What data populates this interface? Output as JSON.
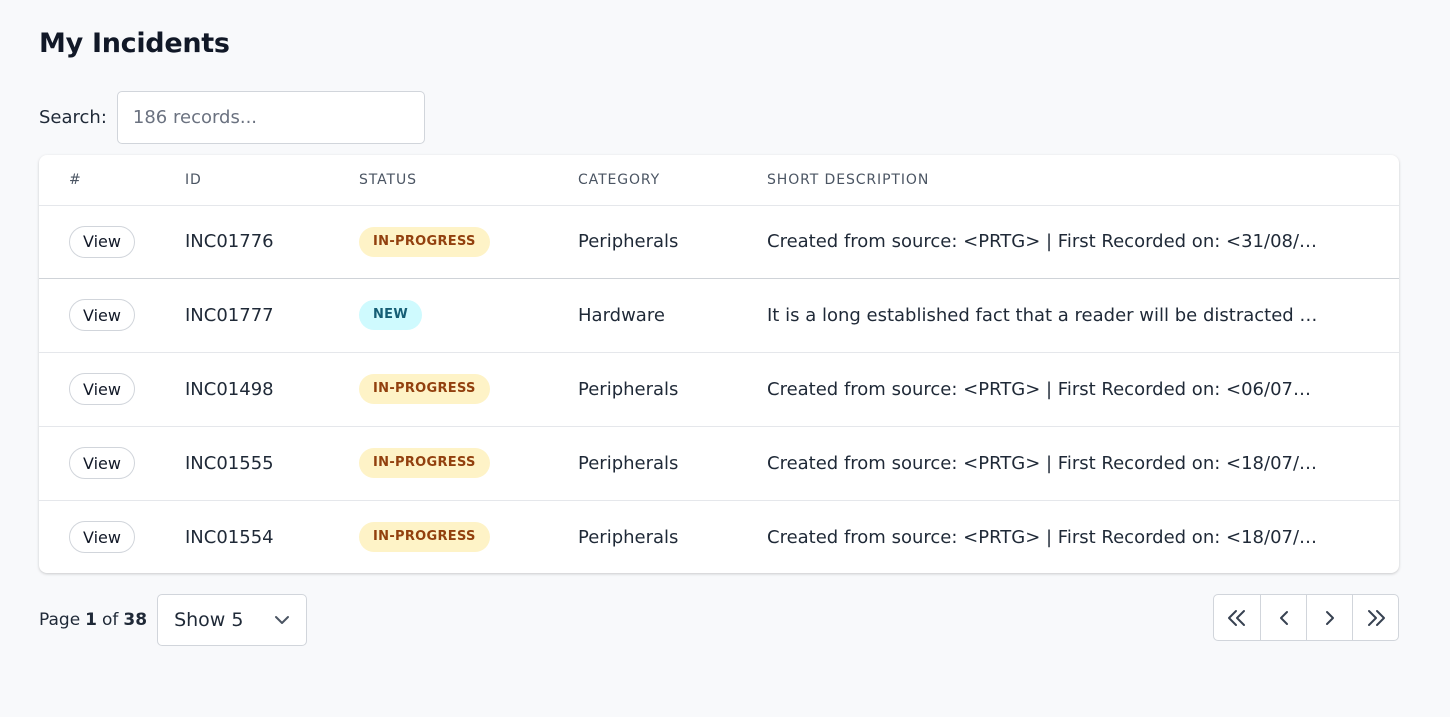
{
  "page": {
    "title": "My Incidents"
  },
  "search": {
    "label": "Search:",
    "placeholder": "186 records..."
  },
  "table": {
    "columns": {
      "num": "#",
      "id": "ID",
      "status": "STATUS",
      "category": "CATEGORY",
      "description": "SHORT DESCRIPTION"
    },
    "rows": [
      {
        "action": "View",
        "id": "INC01776",
        "status": "IN-PROGRESS",
        "category": "Peripherals",
        "description": "Created from source: <PRTG> | First Recorded on: <31/08/…"
      },
      {
        "action": "View",
        "id": "INC01777",
        "status": "NEW",
        "category": "Hardware",
        "description": "It is a long established fact that a reader will be distracted …"
      },
      {
        "action": "View",
        "id": "INC01498",
        "status": "IN-PROGRESS",
        "category": "Peripherals",
        "description": "Created from source: <PRTG> | First Recorded on: <06/07…"
      },
      {
        "action": "View",
        "id": "INC01555",
        "status": "IN-PROGRESS",
        "category": "Peripherals",
        "description": "Created from source: <PRTG> | First Recorded on: <18/07/…"
      },
      {
        "action": "View",
        "id": "INC01554",
        "status": "IN-PROGRESS",
        "category": "Peripherals",
        "description": "Created from source: <PRTG> | First Recorded on: <18/07/…"
      }
    ]
  },
  "status_colors": {
    "IN-PROGRESS": {
      "background": "#fef3c7",
      "text": "#92400e"
    },
    "NEW": {
      "background": "#cffafe",
      "text": "#155e75"
    }
  },
  "pagination": {
    "page_prefix": "Page",
    "current_page": "1",
    "of_label": "of",
    "total_pages": "38",
    "page_size": {
      "selected": "Show 5",
      "icon": "chevron-down-icon"
    },
    "nav_icons": [
      "chevrons-left-icon",
      "chevron-left-icon",
      "chevron-right-icon",
      "chevrons-right-icon"
    ]
  }
}
